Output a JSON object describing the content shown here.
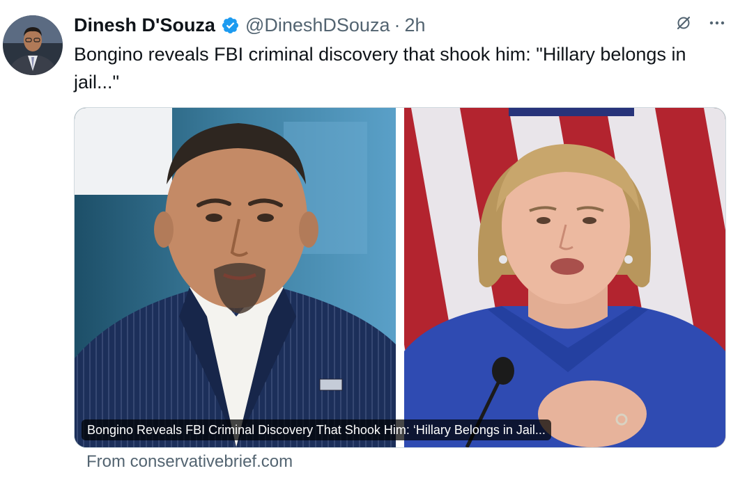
{
  "author": {
    "display_name": "Dinesh D'Souza",
    "handle": "@DineshDSouza",
    "separator": "·",
    "time": "2h",
    "verified_icon": "verified-badge-icon",
    "avatar_icon": "profile-avatar"
  },
  "tweet": {
    "text": "Bongino reveals FBI criminal discovery that shook him: \"Hillary belongs in jail...\""
  },
  "card": {
    "title": "Bongino Reveals FBI Criminal Discovery That Shook Him: ‘Hillary Belongs in Jail...",
    "source": "From conservativebrief.com"
  },
  "actions": {
    "grok_icon": "grok-icon",
    "more_icon": "more-options-icon"
  },
  "colors": {
    "text_primary": "#0f1419",
    "text_secondary": "#536471",
    "verified_blue": "#1d9bf0",
    "border": "#cfd9de"
  }
}
